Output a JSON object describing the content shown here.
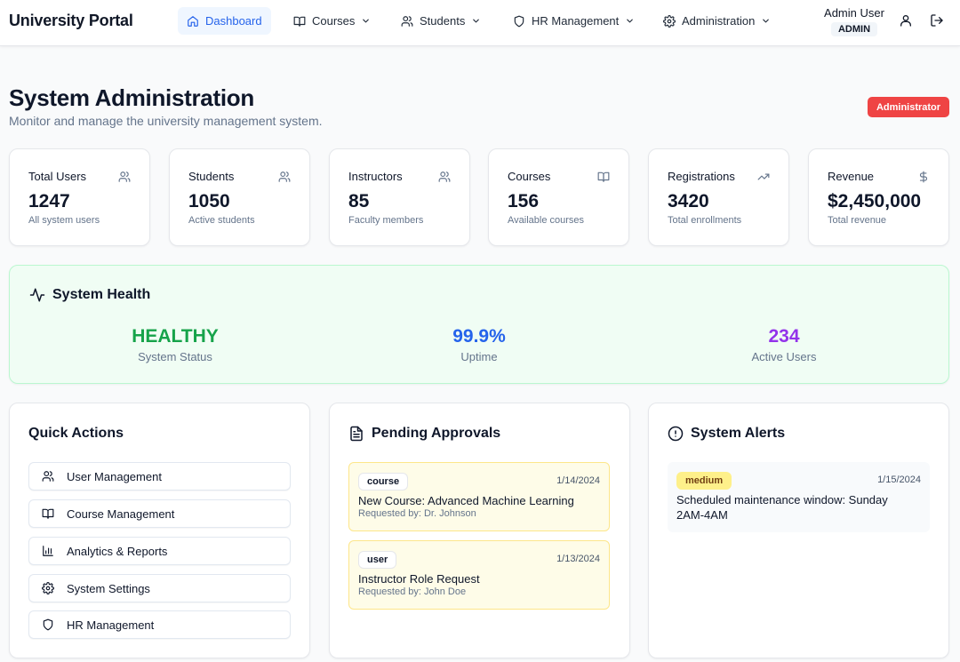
{
  "nav": {
    "brand": "University Portal",
    "items": [
      {
        "label": "Dashboard",
        "icon": "home-icon",
        "active": true
      },
      {
        "label": "Courses",
        "icon": "book-icon"
      },
      {
        "label": "Students",
        "icon": "users-icon"
      },
      {
        "label": "HR Management",
        "icon": "shield-icon"
      },
      {
        "label": "Administration",
        "icon": "gear-icon"
      }
    ],
    "user": {
      "name": "Admin User",
      "role": "ADMIN"
    }
  },
  "header": {
    "title": "System Administration",
    "subtitle": "Monitor and manage the university management system.",
    "badge": "Administrator"
  },
  "stats": [
    {
      "label": "Total Users",
      "value": "1247",
      "desc": "All system users",
      "icon": "users-icon"
    },
    {
      "label": "Students",
      "value": "1050",
      "desc": "Active students",
      "icon": "users-icon"
    },
    {
      "label": "Instructors",
      "value": "85",
      "desc": "Faculty members",
      "icon": "users-icon"
    },
    {
      "label": "Courses",
      "value": "156",
      "desc": "Available courses",
      "icon": "book-icon"
    },
    {
      "label": "Registrations",
      "value": "3420",
      "desc": "Total enrollments",
      "icon": "trending-up-icon"
    },
    {
      "label": "Revenue",
      "value": "$2,450,000",
      "desc": "Total revenue",
      "icon": "dollar-icon"
    }
  ],
  "health": {
    "title": "System Health",
    "metrics": [
      {
        "value": "HEALTHY",
        "label": "System Status",
        "color": "#16a34a"
      },
      {
        "value": "99.9%",
        "label": "Uptime",
        "color": "#2563eb"
      },
      {
        "value": "234",
        "label": "Active Users",
        "color": "#9333ea"
      }
    ]
  },
  "quick_actions": {
    "title": "Quick Actions",
    "items": [
      {
        "label": "User Management",
        "icon": "users-icon"
      },
      {
        "label": "Course Management",
        "icon": "book-icon"
      },
      {
        "label": "Analytics & Reports",
        "icon": "bar-chart-icon"
      },
      {
        "label": "System Settings",
        "icon": "gear-icon"
      },
      {
        "label": "HR Management",
        "icon": "shield-icon"
      }
    ]
  },
  "approvals": {
    "title": "Pending Approvals",
    "items": [
      {
        "type": "course",
        "date": "1/14/2024",
        "title": "New Course: Advanced Machine Learning",
        "requested_by": "Requested by: Dr. Johnson"
      },
      {
        "type": "user",
        "date": "1/13/2024",
        "title": "Instructor Role Request",
        "requested_by": "Requested by: John Doe"
      }
    ]
  },
  "alerts": {
    "title": "System Alerts",
    "items": [
      {
        "severity": "medium",
        "date": "1/15/2024",
        "message": "Scheduled maintenance window: Sunday 2AM-4AM"
      }
    ]
  },
  "colors": {
    "accent": "#2563eb",
    "danger": "#ef4444",
    "health_bg": "#f0fdf4",
    "approval_bg": "#fefce8"
  }
}
